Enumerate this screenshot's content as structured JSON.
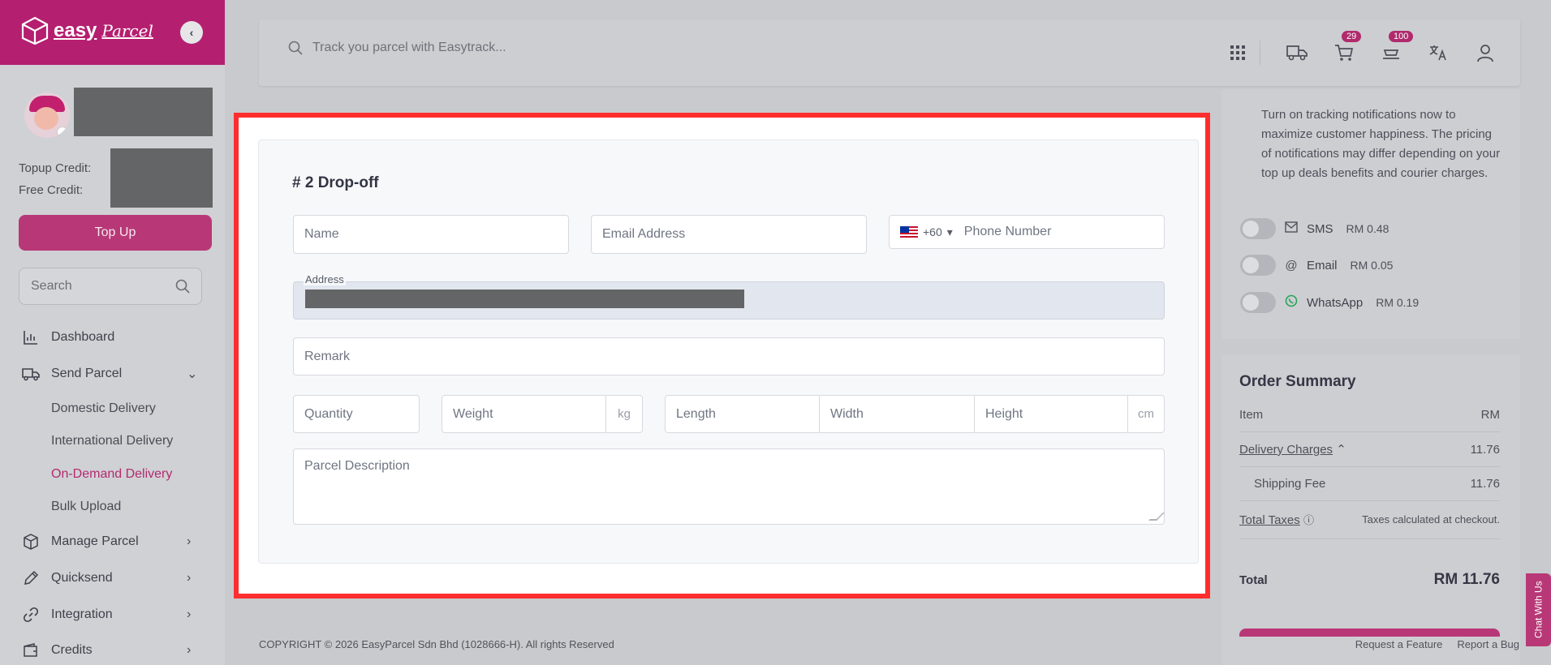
{
  "app": {
    "logo_word": "easy",
    "logo_script": "Parcel"
  },
  "sidebar": {
    "topup_credit_label": "Topup Credit:",
    "free_credit_label": "Free Credit:",
    "topup_button": "Top Up",
    "search_placeholder": "Search",
    "nav": [
      {
        "label": "Dashboard",
        "icon": "bar-chart-icon"
      },
      {
        "label": "Send Parcel",
        "icon": "truck-icon"
      },
      {
        "label": "Manage Parcel",
        "icon": "box-icon"
      },
      {
        "label": "Quicksend",
        "icon": "pencil-icon"
      },
      {
        "label": "Integration",
        "icon": "link-icon"
      },
      {
        "label": "Credits",
        "icon": "wallet-icon"
      }
    ],
    "send_parcel_sub": [
      "Domestic Delivery",
      "International Delivery",
      "On-Demand Delivery",
      "Bulk Upload"
    ]
  },
  "topbar": {
    "search_placeholder": "Track you parcel with Easytrack...",
    "cart_count": "29",
    "notifications_count": "100"
  },
  "form": {
    "title": "# 2 Drop-off",
    "name_placeholder": "Name",
    "email_placeholder": "Email Address",
    "phone_code": "+60",
    "phone_placeholder": "Phone Number",
    "address_label": "Address",
    "remark_placeholder": "Remark",
    "quantity_placeholder": "Quantity",
    "weight_placeholder": "Weight",
    "weight_unit": "kg",
    "length_placeholder": "Length",
    "width_placeholder": "Width",
    "height_placeholder": "Height",
    "dimension_unit": "cm",
    "description_placeholder": "Parcel Description"
  },
  "notifications": {
    "text": "Turn on tracking notifications now to maximize customer happiness. The pricing of notifications may differ depending on your top up deals benefits and courier charges.",
    "options": [
      {
        "label": "SMS",
        "price": "RM 0.48",
        "icon": "mail-icon",
        "enabled": false
      },
      {
        "label": "Email",
        "price": "RM 0.05",
        "icon": "at-icon",
        "enabled": false
      },
      {
        "label": "WhatsApp",
        "price": "RM 0.19",
        "icon": "whatsapp-icon",
        "enabled": false
      }
    ]
  },
  "order_summary": {
    "title": "Order Summary",
    "item_label": "Item",
    "currency_label": "RM",
    "delivery_charges_label": "Delivery Charges",
    "delivery_charges_value": "11.76",
    "shipping_fee_label": "Shipping Fee",
    "shipping_fee_value": "11.76",
    "total_taxes_label": "Total Taxes",
    "total_taxes_value": "Taxes calculated at checkout.",
    "total_label": "Total",
    "total_value": "RM 11.76"
  },
  "chat_tab": "Chat With Us",
  "footer": {
    "copyright": "COPYRIGHT © 2026 EasyParcel Sdn Bhd (1028666-H). All rights Reserved",
    "request_feature": "Request a Feature",
    "report_bug": "Report a Bug"
  },
  "colors": {
    "brand": "#b51f70",
    "highlight": "#ff2e2e"
  }
}
